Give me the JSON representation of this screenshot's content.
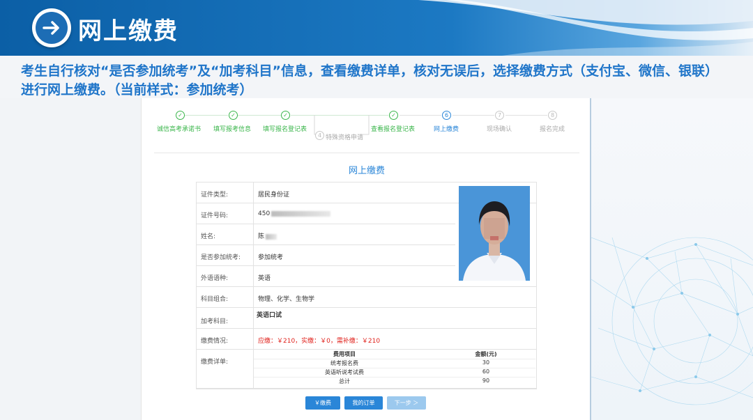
{
  "banner": {
    "title": "网上缴费"
  },
  "intro": "考生自行核对“是否参加统考”及“加考科目”信息，查看缴费详单，核对无误后，选择缴费方式（支付宝、微信、银联）进行网上缴费。（当前样式：参加统考）",
  "steps": [
    {
      "num": "✓",
      "label": "诚信高考承诺书",
      "state": "done"
    },
    {
      "num": "✓",
      "label": "填写报考信息",
      "state": "done"
    },
    {
      "num": "✓",
      "label": "填写报名登记表",
      "state": "done"
    },
    {
      "num": "4",
      "label": "特殊资格申请",
      "state": "todo"
    },
    {
      "num": "✓",
      "label": "查看报名登记表",
      "state": "done"
    },
    {
      "num": "6",
      "label": "网上缴费",
      "state": "current"
    },
    {
      "num": "7",
      "label": "现场确认",
      "state": "todo"
    },
    {
      "num": "8",
      "label": "报名完成",
      "state": "todo"
    }
  ],
  "form": {
    "title": "网上缴费",
    "id_type_label": "证件类型:",
    "id_type_value": "居民身份证",
    "id_number_label": "证件号码:",
    "id_number_value": "450",
    "name_label": "姓名:",
    "name_value": "陈",
    "exam_label": "是否参加统考:",
    "exam_value": "参加统考",
    "language_label": "外语语种:",
    "language_value": "英语",
    "subjects_label": "科目组合:",
    "subjects_value": "物理、化学、生物学",
    "extra_label": "加考科目:",
    "extra_value": "英语口试",
    "payment_status_label": "缴费情况:",
    "payment_status_value": "应缴：￥210，实缴：￥0，需补缴：￥210",
    "payment_detail_label": "缴费详单:",
    "fee_headers": [
      "费用项目",
      "金额(元)"
    ],
    "fee_rows": [
      [
        "统考报名费",
        "30"
      ],
      [
        "英语听说考试费",
        "60"
      ],
      [
        "总计",
        "90"
      ]
    ]
  },
  "buttons": {
    "pay": "￥缴费",
    "orders": "我的订单",
    "next": "下一步 ＞"
  },
  "colors": {
    "primary": "#2a86d8",
    "done": "#39b54a",
    "alert": "#e0221c",
    "intro": "#1f75c9"
  }
}
